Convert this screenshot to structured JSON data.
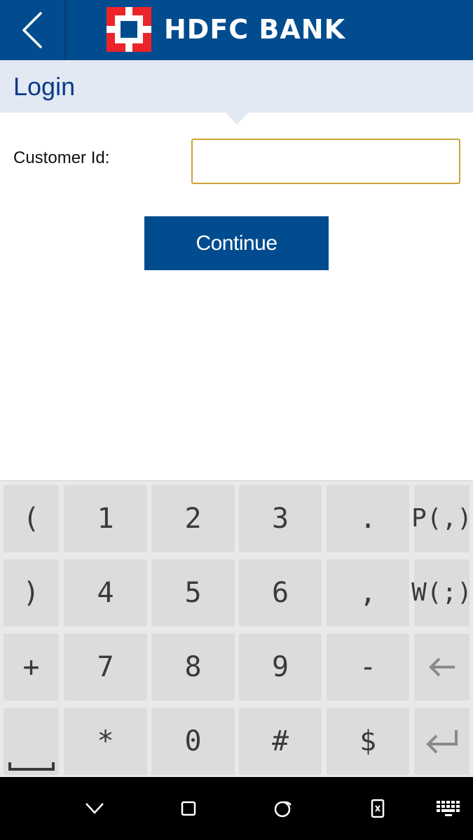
{
  "header": {
    "brand_name": "HDFC BANK",
    "bg_color": "#004c8f",
    "back_icon": "chevron-left-icon",
    "logo_icon": "hdfc-logo-icon"
  },
  "page": {
    "title": "Login"
  },
  "form": {
    "customer_id_label": "Customer Id:",
    "customer_id_value": "",
    "input_border_color": "#c9a33a"
  },
  "actions": {
    "continue_label": "Continue"
  },
  "keypad": {
    "rows": [
      [
        "(",
        "1",
        "2",
        "3",
        ".",
        "P(,)"
      ],
      [
        ")",
        "4",
        "5",
        "6",
        ",",
        "W(;)"
      ],
      [
        "+",
        "7",
        "8",
        "9",
        "-",
        "backspace"
      ],
      [
        "space",
        "*",
        "0",
        "#",
        "$",
        "enter"
      ]
    ]
  },
  "navbar": {
    "icons": [
      "hide-keyboard-icon",
      "recents-icon",
      "home-icon",
      "screen-pin-icon",
      "keyboard-icon"
    ]
  }
}
